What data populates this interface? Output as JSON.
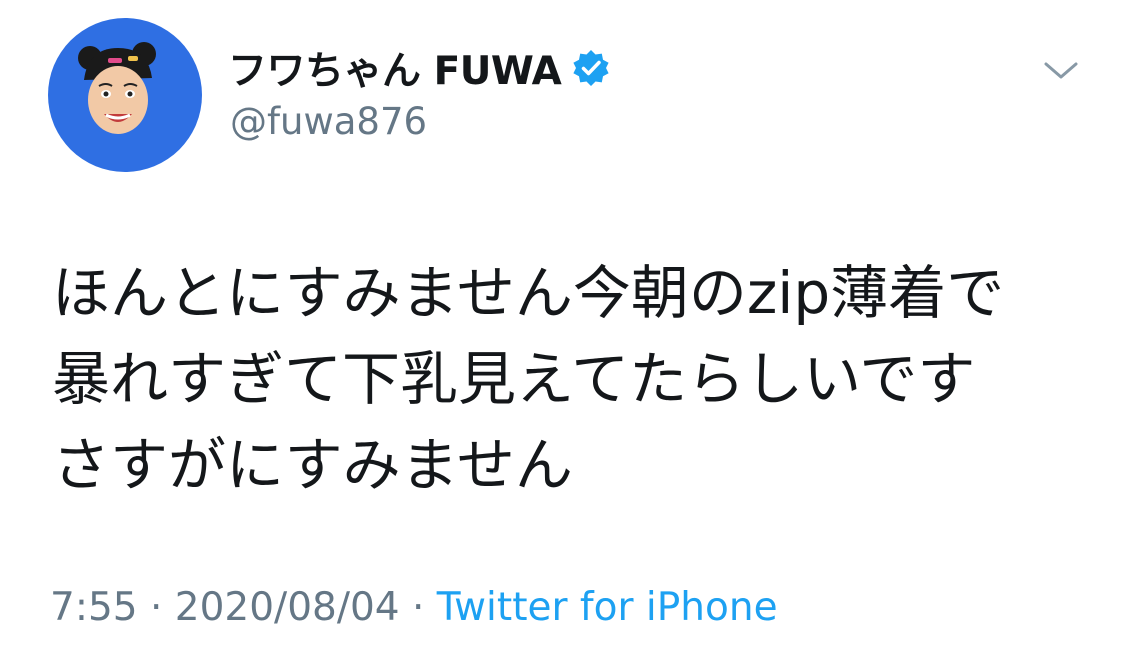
{
  "tweet": {
    "display_name": "フワちゃん FUWA",
    "handle": "@fuwa876",
    "verified_icon": "verified-badge-icon",
    "caret_icon": "chevron-down-icon",
    "text_lines": [
      "ほんとにすみません今朝のzip薄着で",
      "暴れすぎて下乳見えてたらしいです",
      "さすがにすみません"
    ],
    "time": "7:55",
    "date": "2020/08/04",
    "separator": " · ",
    "source": "Twitter for iPhone"
  },
  "colors": {
    "avatar_bg": "#2f6fe3",
    "name": "#14171a",
    "secondary": "#657786",
    "link": "#1da1f2",
    "verified": "#1da1f2"
  }
}
